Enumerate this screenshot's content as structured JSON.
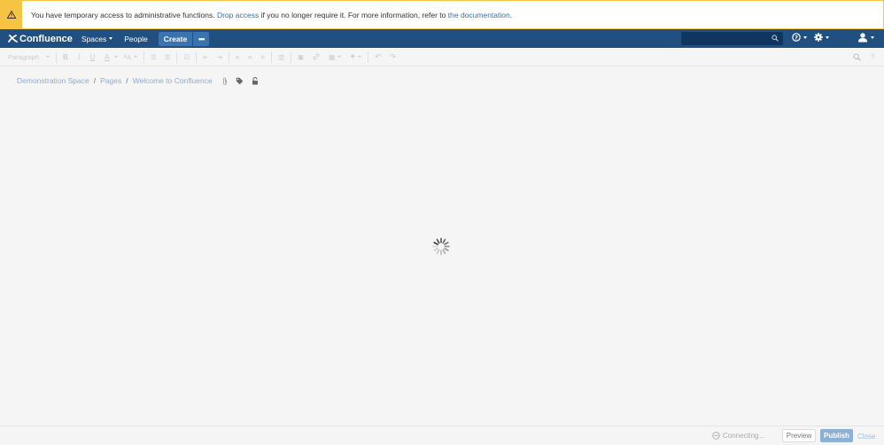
{
  "banner": {
    "text_before": "You have temporary access to administrative functions.",
    "drop_access_link": "Drop access",
    "text_middle": "if you no longer require it. For more information, refer to",
    "documentation_link": "the documentation",
    "text_after": "."
  },
  "header": {
    "logo": "Confluence",
    "spaces": "Spaces",
    "people": "People",
    "create": "Create",
    "more": "•••",
    "search_placeholder": ""
  },
  "toolbar": {
    "paragraph": "Paragraph",
    "bold": "B",
    "italic": "I",
    "underline": "U",
    "text_color": "A",
    "font_size": "ᴬA",
    "bullet_list": "☰",
    "numbered_list": "☰",
    "task_list": "☑",
    "outdent": "⇤",
    "indent": "⇥",
    "align_left": "≡",
    "align_center": "≡",
    "align_right": "≡",
    "page_layout": "▥",
    "insert_image": "▣",
    "insert_link": "🔗",
    "table": "▦",
    "insert_more": "+",
    "undo": "↶",
    "redo": "↷",
    "find": "⌕",
    "help": "?"
  },
  "breadcrumb": {
    "space": "Demonstration Space",
    "pages": "Pages",
    "page": "Welcome to Confluence",
    "separator": "/"
  },
  "footer": {
    "status": "Connecting...",
    "preview": "Preview",
    "publish": "Publish",
    "close": "Close"
  },
  "colors": {
    "header_bg": "#205081",
    "banner_accent": "#f6c342",
    "link": "#3572b0",
    "publish_disabled": "#8eb0d5"
  }
}
